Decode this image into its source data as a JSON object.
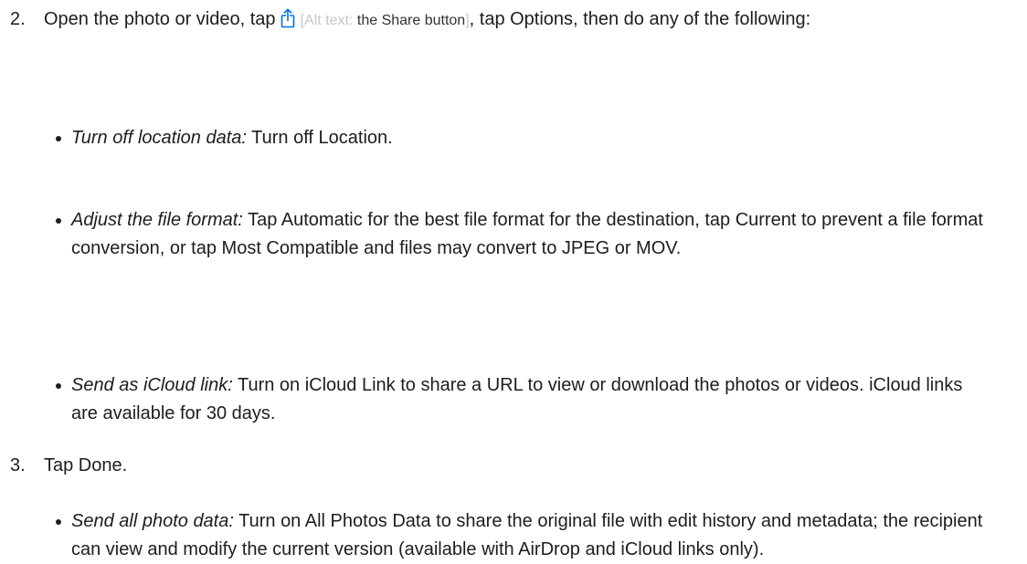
{
  "steps": {
    "step2": {
      "number": "2.",
      "text_before_icon": "Open the photo or video, tap",
      "icon": "share-icon",
      "alt_prefix": "[Alt text: ",
      "alt_value": "the Share button",
      "alt_suffix": "]",
      "text_after_icon": ", tap Options, then do any of the following:"
    },
    "options": [
      {
        "term": "Turn off location data:",
        "description": "Turn off Location."
      },
      {
        "term": "Adjust the file format:",
        "description": "Tap Automatic for the best file format for the destination, tap Current to prevent a file format conversion, or tap Most Compatible and files may convert to JPEG or MOV."
      },
      {
        "term": "Send as iCloud link:",
        "description": "Turn on iCloud Link to share a URL to view or download the photos or videos. iCloud links are available for 30 days."
      },
      {
        "term": "Send all photo data:",
        "description": "Turn on All Photos Data to share the original file with edit history and metadata; the recipient can view and modify the current version (available with AirDrop and iCloud links only)."
      }
    ],
    "step3": {
      "number": "3.",
      "text": "Tap Done."
    }
  },
  "colors": {
    "text": "#1d1d1f",
    "icon": "#0071e3",
    "alt_text": "#c7c7cc"
  }
}
